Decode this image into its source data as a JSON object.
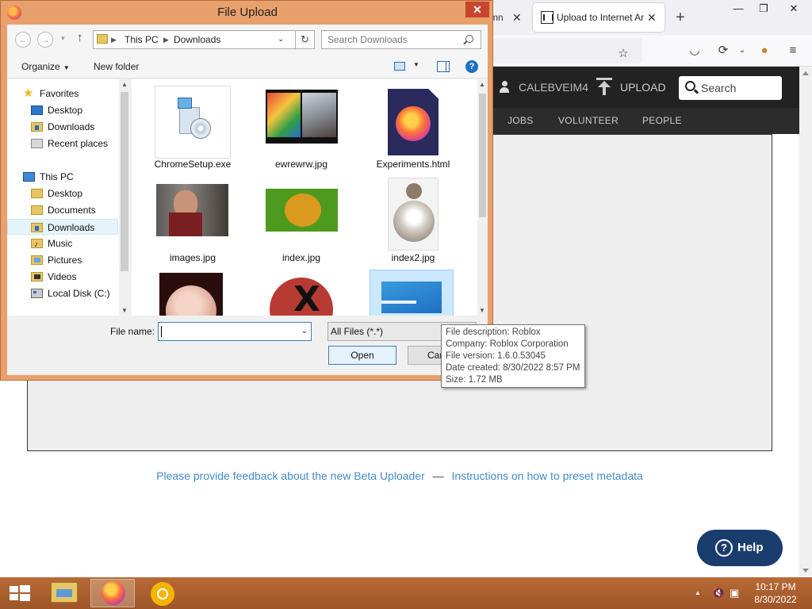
{
  "browser": {
    "partial_tab_text": "mn",
    "active_tab_title": "Upload to Internet Archive",
    "new_tab_symbol": "+",
    "close_symbol": "✕",
    "window_controls": [
      "—",
      "❐",
      "✕"
    ]
  },
  "site": {
    "username": "CALEBVEIM4",
    "upload_label": "UPLOAD",
    "search_placeholder": "Search",
    "nav": [
      "JOBS",
      "VOLUNTEER",
      "PEOPLE"
    ],
    "feedback_link": "Please provide feedback about the new Beta Uploader",
    "feedback_sep": "—",
    "instructions_link": "Instructions on how to preset metadata",
    "help_label": "Help"
  },
  "dialog": {
    "title": "File Upload",
    "address": [
      "This PC",
      "Downloads"
    ],
    "search_placeholder": "Search Downloads",
    "organize_label": "Organize",
    "new_folder_label": "New folder",
    "nav_items": [
      {
        "label": "Favorites",
        "icon": "star-icon"
      },
      {
        "label": "Desktop",
        "icon": "desktop-icon"
      },
      {
        "label": "Downloads",
        "icon": "downloads-folder-icon"
      },
      {
        "label": "Recent places",
        "icon": "recent-places-icon"
      },
      {
        "label": "This PC",
        "icon": "computer-icon"
      },
      {
        "label": "Desktop",
        "icon": "desktop-folder-icon"
      },
      {
        "label": "Documents",
        "icon": "documents-folder-icon"
      },
      {
        "label": "Downloads",
        "icon": "downloads-folder-icon",
        "selected": true
      },
      {
        "label": "Music",
        "icon": "music-folder-icon"
      },
      {
        "label": "Pictures",
        "icon": "pictures-folder-icon"
      },
      {
        "label": "Videos",
        "icon": "videos-folder-icon"
      },
      {
        "label": "Local Disk (C:)",
        "icon": "local-disk-icon"
      }
    ],
    "files": [
      {
        "name": "ChromeSetup.exe",
        "icon": "installer-icon"
      },
      {
        "name": "ewrewrw.jpg",
        "icon": "image-thumbnail"
      },
      {
        "name": "Experiments.html",
        "icon": "firefox-html-icon"
      },
      {
        "name": "images.jpg",
        "icon": "image-thumbnail"
      },
      {
        "name": "index.jpg",
        "icon": "image-thumbnail"
      },
      {
        "name": "index2.jpg",
        "icon": "image-thumbnail"
      },
      {
        "name": "",
        "icon": "image-thumbnail"
      },
      {
        "name": "",
        "icon": "image-thumbnail"
      },
      {
        "name": "",
        "icon": "roblox-icon"
      }
    ],
    "file_name_label": "File name:",
    "file_name_value": "",
    "file_type": "All Files (*.*)",
    "open_label": "Open",
    "cancel_label": "Cancel"
  },
  "tooltip": {
    "description": "File description: Roblox",
    "company": "Company: Roblox Corporation",
    "version": "File version: 1.6.0.53045",
    "created": "Date created: 8/30/2022 8:57 PM",
    "size": "Size: 1.72 MB"
  },
  "taskbar": {
    "time": "10:17 PM",
    "date": "8/30/2022"
  }
}
